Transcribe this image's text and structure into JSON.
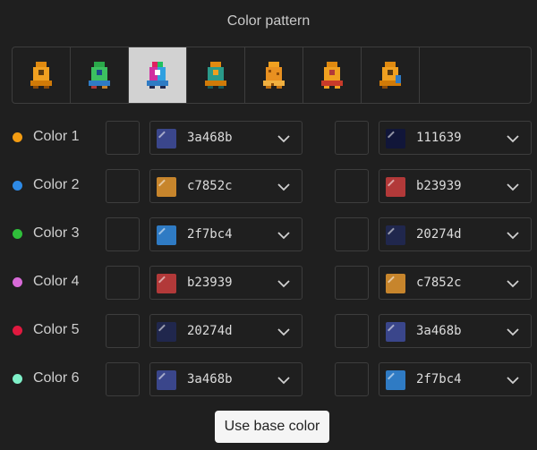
{
  "title": "Color pattern",
  "patterns": [
    {
      "icon": "sprite-orange-pattern-icon",
      "selected": false
    },
    {
      "icon": "sprite-green-blue-pattern-icon",
      "selected": false
    },
    {
      "icon": "sprite-rainbow-pattern-icon",
      "selected": true
    },
    {
      "icon": "sprite-orange-teal-pattern-icon",
      "selected": false
    },
    {
      "icon": "sprite-orange-spotted-pattern-icon",
      "selected": false
    },
    {
      "icon": "sprite-orange-red-pattern-icon",
      "selected": false
    },
    {
      "icon": "sprite-orange-blue-pattern-icon",
      "selected": false
    }
  ],
  "rows": [
    {
      "label": "Color 1",
      "dot": "#f39c12",
      "left": {
        "hex": "3a468b",
        "color": "#3a468b"
      },
      "right": {
        "hex": "111639",
        "color": "#111639"
      }
    },
    {
      "label": "Color 2",
      "dot": "#2e8ae6",
      "left": {
        "hex": "c7852c",
        "color": "#c7852c"
      },
      "right": {
        "hex": "b23939",
        "color": "#b23939"
      }
    },
    {
      "label": "Color 3",
      "dot": "#2fbf3a",
      "left": {
        "hex": "2f7bc4",
        "color": "#2f7bc4"
      },
      "right": {
        "hex": "20274d",
        "color": "#20274d"
      }
    },
    {
      "label": "Color 4",
      "dot": "#d86ad8",
      "left": {
        "hex": "b23939",
        "color": "#b23939"
      },
      "right": {
        "hex": "c7852c",
        "color": "#c7852c"
      }
    },
    {
      "label": "Color 5",
      "dot": "#e0193f",
      "left": {
        "hex": "20274d",
        "color": "#20274d"
      },
      "right": {
        "hex": "3a468b",
        "color": "#3a468b"
      }
    },
    {
      "label": "Color 6",
      "dot": "#7ff0c8",
      "left": {
        "hex": "3a468b",
        "color": "#3a468b"
      },
      "right": {
        "hex": "2f7bc4",
        "color": "#2f7bc4"
      }
    }
  ],
  "base_button_label": "Use base color"
}
